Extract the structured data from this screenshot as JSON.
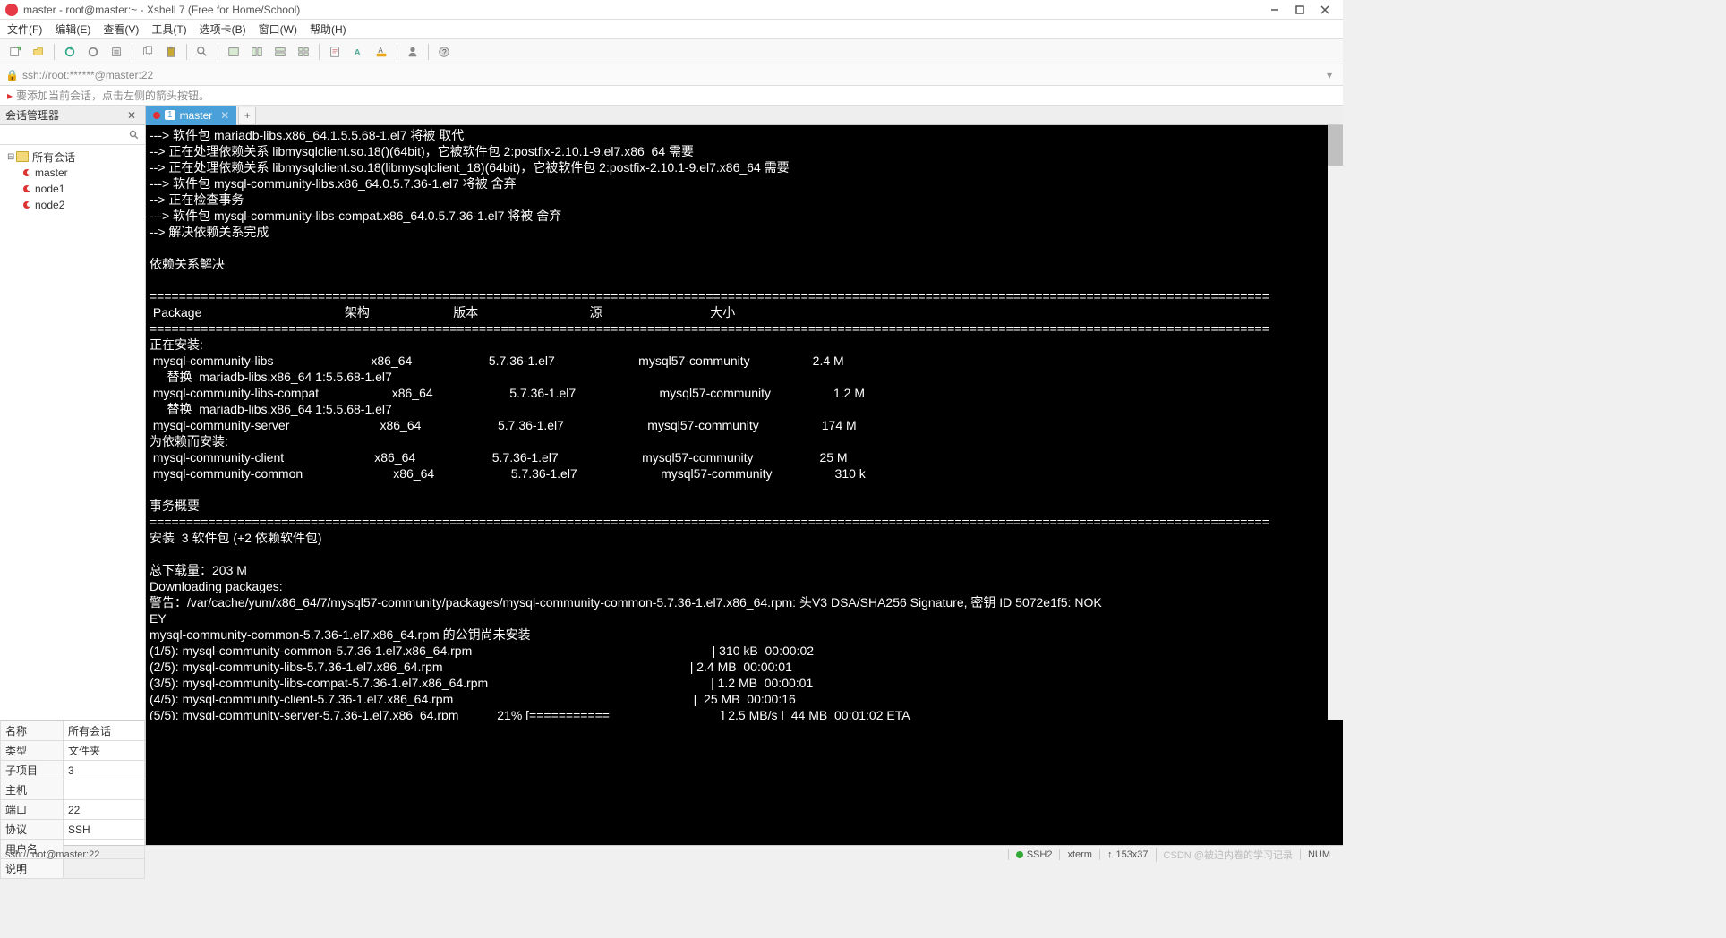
{
  "window": {
    "title": "master - root@master:~ - Xshell 7 (Free for Home/School)"
  },
  "menu": {
    "file": "文件(F)",
    "edit": "编辑(E)",
    "view": "查看(V)",
    "tools": "工具(T)",
    "tabs": "选项卡(B)",
    "window": "窗口(W)",
    "help": "帮助(H)"
  },
  "addressbar": {
    "text": "ssh://root:******@master:22"
  },
  "infobar": {
    "text": "要添加当前会话，点击左侧的箭头按钮。"
  },
  "sidebar": {
    "title": "会话管理器",
    "root": "所有会话",
    "nodes": [
      "master",
      "node1",
      "node2"
    ]
  },
  "tab": {
    "num": "1",
    "label": "master"
  },
  "props": {
    "labels": {
      "name": "名称",
      "type": "类型",
      "subitems": "子项目",
      "host": "主机",
      "port": "端口",
      "protocol": "协议",
      "user": "用户名",
      "desc": "说明"
    },
    "values": {
      "name": "所有会话",
      "type": "文件夹",
      "subitems": "3",
      "host": "",
      "port": "22",
      "protocol": "SSH",
      "user": "",
      "desc": ""
    }
  },
  "term_lines": [
    "---> 软件包 mariadb-libs.x86_64.1.5.5.68-1.el7 将被 取代",
    "--> 正在处理依赖关系 libmysqlclient.so.18()(64bit)，它被软件包 2:postfix-2.10.1-9.el7.x86_64 需要",
    "--> 正在处理依赖关系 libmysqlclient.so.18(libmysqlclient_18)(64bit)，它被软件包 2:postfix-2.10.1-9.el7.x86_64 需要",
    "---> 软件包 mysql-community-libs.x86_64.0.5.7.36-1.el7 将被 舍弃",
    "--> 正在检查事务",
    "---> 软件包 mysql-community-libs-compat.x86_64.0.5.7.36-1.el7 将被 舍弃",
    "--> 解决依赖关系完成",
    "",
    "依赖关系解决",
    "",
    "=========================================================================================================================================================",
    " Package                                         架构                        版本                                源                               大小",
    "=========================================================================================================================================================",
    "正在安装:",
    " mysql-community-libs                            x86_64                      5.7.36-1.el7                        mysql57-community                  2.4 M",
    "     替换  mariadb-libs.x86_64 1:5.5.68-1.el7",
    " mysql-community-libs-compat                     x86_64                      5.7.36-1.el7                        mysql57-community                  1.2 M",
    "     替换  mariadb-libs.x86_64 1:5.5.68-1.el7",
    " mysql-community-server                          x86_64                      5.7.36-1.el7                        mysql57-community                  174 M",
    "为依赖而安装:",
    " mysql-community-client                          x86_64                      5.7.36-1.el7                        mysql57-community                   25 M",
    " mysql-community-common                          x86_64                      5.7.36-1.el7                        mysql57-community                  310 k",
    "",
    "事务概要",
    "=========================================================================================================================================================",
    "安装  3 软件包 (+2 依赖软件包)",
    "",
    "总下载量：203 M",
    "Downloading packages:",
    "警告：/var/cache/yum/x86_64/7/mysql57-community/packages/mysql-community-common-5.7.36-1.el7.x86_64.rpm: 头V3 DSA/SHA256 Signature, 密钥 ID 5072e1f5: NOK",
    "EY",
    "mysql-community-common-5.7.36-1.el7.x86_64.rpm 的公钥尚未安装",
    "(1/5): mysql-community-common-5.7.36-1.el7.x86_64.rpm                                                                     | 310 kB  00:00:02",
    "(2/5): mysql-community-libs-5.7.36-1.el7.x86_64.rpm                                                                       | 2.4 MB  00:00:01",
    "(3/5): mysql-community-libs-compat-5.7.36-1.el7.x86_64.rpm                                                                | 1.2 MB  00:00:01",
    "(4/5): mysql-community-client-5.7.36-1.el7.x86_64.rpm                                                                     |  25 MB  00:00:16",
    "(5/5): mysql-community-server-5.7.36-1.el7.x86_64.rpm           21% [===========                                ] 2.5 MB/s |  44 MB  00:01:02 ETA"
  ],
  "status": {
    "left": "ssh://root@master:22",
    "ssh": "SSH2",
    "term": "xterm",
    "size": "153x37",
    "watermark": "CSDN @被迫内卷的学习记录",
    "caps": "NUM"
  }
}
